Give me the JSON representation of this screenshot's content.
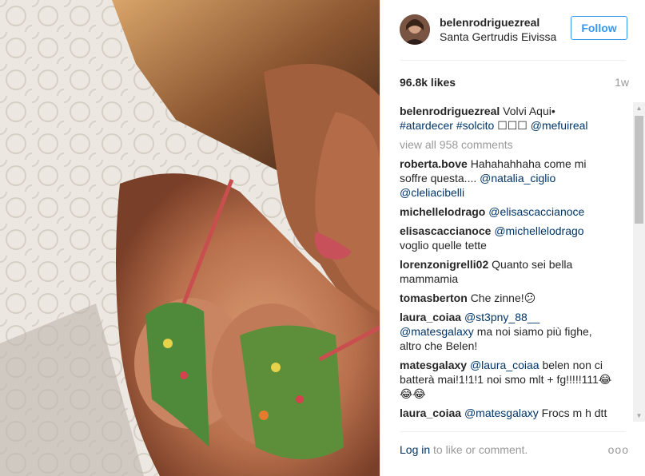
{
  "post": {
    "username": "belenrodriguezreal",
    "location": "Santa Gertrudis Eivissa",
    "follow_label": "Follow",
    "likes": "96.8k likes",
    "time": "1w"
  },
  "caption": {
    "username": "belenrodriguezreal",
    "text": "Volvi Aqui•",
    "hashtags": "#atardecer #solcito",
    "emoji": "☐☐☐",
    "mention": "@mefuireal"
  },
  "view_all": "view all 958 comments",
  "comments": [
    {
      "user": "roberta.bove",
      "text": "Hahahahhaha come mi soffre questa....",
      "mention": "@natalia_ciglio @cleliacibelli"
    },
    {
      "user": "michellelodrago",
      "text": "",
      "mention": "@elisascaccianoce"
    },
    {
      "user": "elisascaccianoce",
      "mention": "@michellelodrago",
      "text": "voglio quelle tette"
    },
    {
      "user": "lorenzonigrelli02",
      "text": "Quanto sei bella mammamia",
      "mention": ""
    },
    {
      "user": "tomasberton",
      "text": "Che zinne!😕",
      "mention": ""
    },
    {
      "user": "laura_coiaa",
      "mention": "@st3pny_88__ @matesgalaxy",
      "text": "ma noi siamo più fighe, altro che Belen!"
    },
    {
      "user": "matesgalaxy",
      "mention": "@laura_coiaa",
      "text": "belen non ci batterà mai!1!1!1 noi smo mlt + fg!!!!!111😂😂😂"
    },
    {
      "user": "laura_coiaa",
      "mention": "@matesgalaxy",
      "text": "Frocs m h dtt"
    }
  ],
  "footer": {
    "login": "Log in",
    "text": "to like or comment.",
    "more": "ooo"
  },
  "icons": {
    "more": "more-options-icon",
    "scroll_up": "scroll-up-icon",
    "scroll_down": "scroll-down-icon"
  },
  "colors": {
    "accent": "#3897f0",
    "link": "#003569",
    "muted": "#999999"
  }
}
